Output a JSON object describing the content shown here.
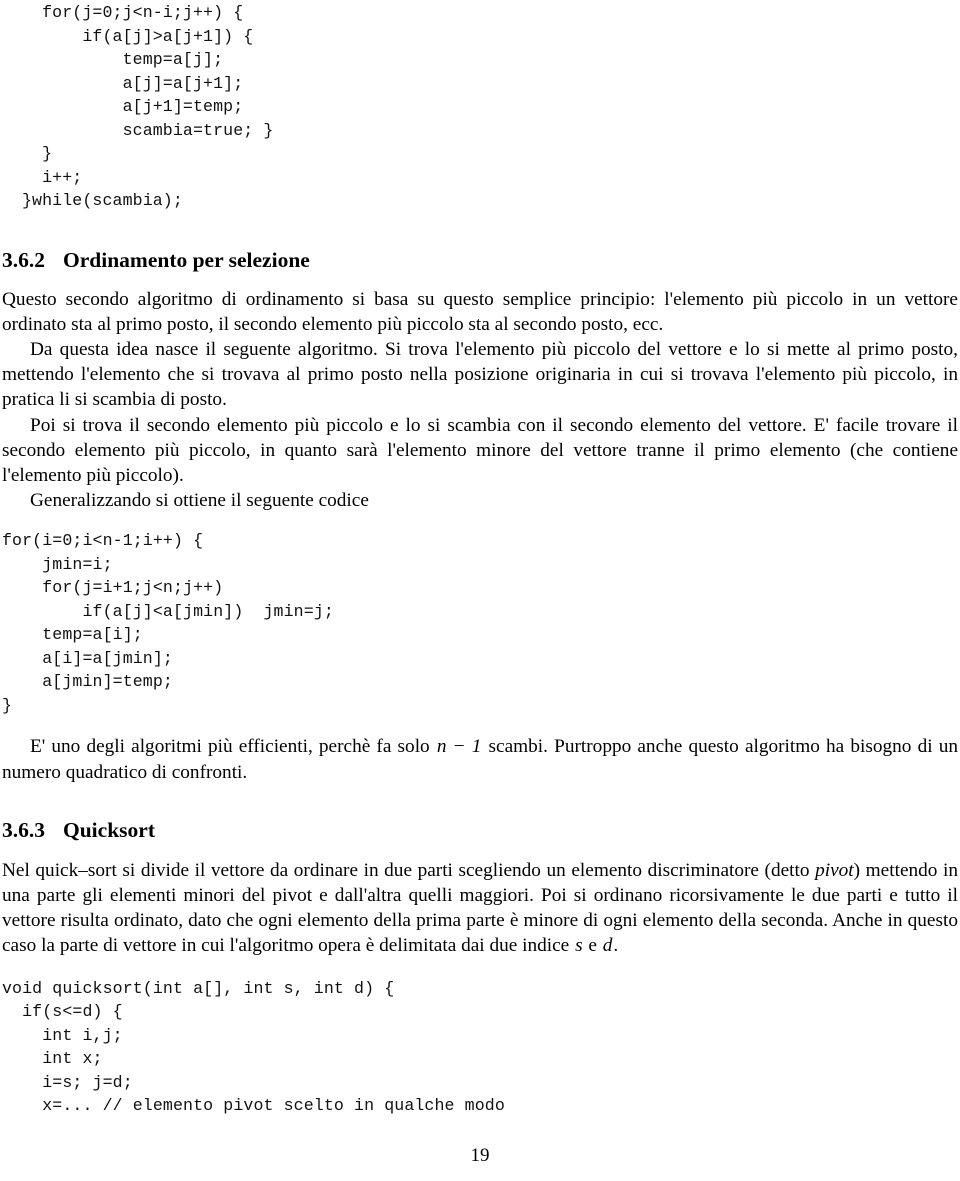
{
  "document": {
    "page_number": "19",
    "language": "it"
  },
  "code_blocks": {
    "bubble_sort_tail": "  for(j=0;j<n-i;j++) {\n      if(a[j]>a[j+1]) {\n          temp=a[j];\n          a[j]=a[j+1];\n          a[j+1]=temp;\n          scambia=true; }\n  }\n  i++;\n}while(scambia);",
    "selection_sort": "for(i=0;i<n-1;i++) {\n    jmin=i;\n    for(j=i+1;j<n;j++)\n        if(a[j]<a[jmin])  jmin=j;\n    temp=a[i];\n    a[i]=a[jmin];\n    a[jmin]=temp;\n}",
    "quicksort": "void quicksort(int a[], int s, int d) {\n  if(s<=d) {\n    int i,j;\n    int x;\n    i=s; j=d;\n    x=... // elemento pivot scelto in qualche modo"
  },
  "sections": {
    "selezione": {
      "number": "3.6.2",
      "title": "Ordinamento per selezione",
      "paragraphs": {
        "p1": "Questo secondo algoritmo di ordinamento si basa su questo semplice principio: l'elemento più piccolo in un vettore ordinato sta al primo posto, il secondo elemento più piccolo sta al secondo posto, ecc.",
        "p2": "Da questa idea nasce il seguente algoritmo. Si trova l'elemento più piccolo del vettore e lo si mette al primo posto, mettendo l'elemento che si trovava al primo posto nella posizione originaria in cui si trovava l'elemento più piccolo, in pratica li si scambia di posto.",
        "p3": "Poi si trova il secondo elemento più piccolo e lo si scambia con il secondo elemento del vettore. E' facile trovare il secondo elemento più piccolo, in quanto sarà l'elemento minore del vettore tranne il primo elemento (che contiene l'elemento più piccolo).",
        "p4": "Generalizzando si ottiene il seguente codice",
        "p5_part1": "E' uno degli algoritmi più efficienti, perchè fa solo ",
        "p5_math": "n − 1",
        "p5_part2": " scambi. Purtroppo anche questo algoritmo ha bisogno di un numero quadratico di confronti."
      }
    },
    "quicksort": {
      "number": "3.6.3",
      "title": "Quicksort",
      "paragraphs": {
        "p1_part1": "Nel quick–sort si divide il vettore da ordinare in due parti scegliendo un elemento discriminatore (detto ",
        "p1_italic": "pivot",
        "p1_part2": ") mettendo in una parte gli elementi minori del pivot e dall'altra quelli maggiori. Poi si ordinano ricorsivamente le due parti e tutto il vettore risulta ordinato, dato che ogni elemento della prima parte è minore di ogni elemento della seconda. Anche in questo caso la parte di vettore in cui l'algoritmo opera è delimitata dai due indice ",
        "p1_math_s": "s",
        "p1_part3": " e ",
        "p1_math_d": "d",
        "p1_part4": "."
      }
    }
  }
}
